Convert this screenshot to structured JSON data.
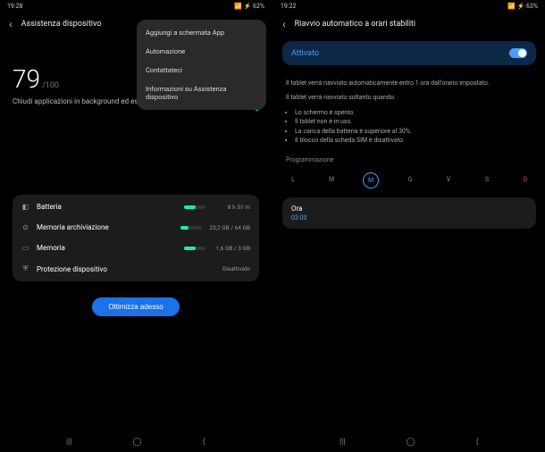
{
  "left": {
    "status": {
      "time": "19:28",
      "battery": "62%"
    },
    "title": "Assistenza dispositivo",
    "menu": [
      "Aggiungi a schermata App",
      "Automazione",
      "Contattateci",
      "Informazioni su Assistenza dispositivo"
    ],
    "score": "79",
    "score_max": "/100",
    "subtitle": "Chiudi applicazioni in background ed esegui controlli",
    "rows": [
      {
        "icon": "◧",
        "label": "Batteria",
        "val": "8 h 51 m",
        "fill": 55
      },
      {
        "icon": "⊙",
        "label": "Memoria archiviazione",
        "val": "23,2 GB / 64 GB",
        "fill": 36
      },
      {
        "icon": "▭",
        "label": "Memoria",
        "val": "1,6 GB / 3 GB",
        "fill": 55
      },
      {
        "icon": "⛨",
        "label": "Protezione dispositivo",
        "val": "Disattivato",
        "fill": null
      }
    ],
    "optimize": "Ottimizza adesso"
  },
  "right": {
    "status": {
      "time": "19:22",
      "battery": "63%"
    },
    "title": "Riavvio automatico a orari stabiliti",
    "toggle_label": "Attivato",
    "info1": "Il tablet verrà riavviato automaticamente entro 1 ora dall'orario impostato.",
    "info2": "Il tablet verrà riavviato soltanto quando:",
    "conds": [
      "Lo schermo è spento.",
      "Il tablet non è in uso.",
      "La carica della batteria è superiore al 30%.",
      "Il blocco della scheda SIM è disattivato."
    ],
    "schedule_label": "Programmazione",
    "days": [
      "L",
      "M",
      "M",
      "G",
      "V",
      "S",
      "D"
    ],
    "selected_day_index": 2,
    "time_label": "Ora",
    "time_val": "03:00"
  }
}
